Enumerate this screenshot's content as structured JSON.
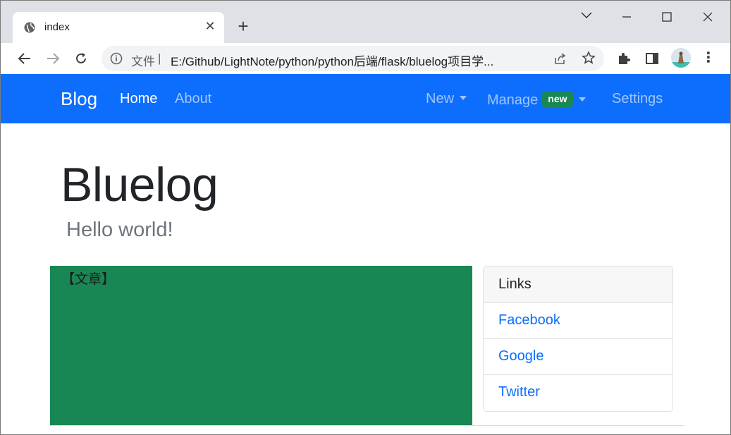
{
  "browser": {
    "tab_title": "index",
    "url_scheme": "文件",
    "url": "E:/Github/LightNote/python/python后端/flask/bluelog项目学..."
  },
  "navbar": {
    "brand": "Blog",
    "links": [
      {
        "label": "Home",
        "active": true
      },
      {
        "label": "About",
        "active": false
      }
    ],
    "right_links": {
      "new": "New",
      "manage": "Manage",
      "manage_badge": "new",
      "settings": "Settings"
    },
    "colors": {
      "navbar_bg": "#0d6efd",
      "badge_bg": "#198754"
    }
  },
  "header": {
    "title": "Bluelog",
    "subtitle": "Hello world!"
  },
  "main": {
    "section_label": "【文章】",
    "section_bg": "#198754"
  },
  "sidebar": {
    "card_title": "Links",
    "links": [
      "Facebook",
      "Google",
      "Twitter"
    ]
  }
}
